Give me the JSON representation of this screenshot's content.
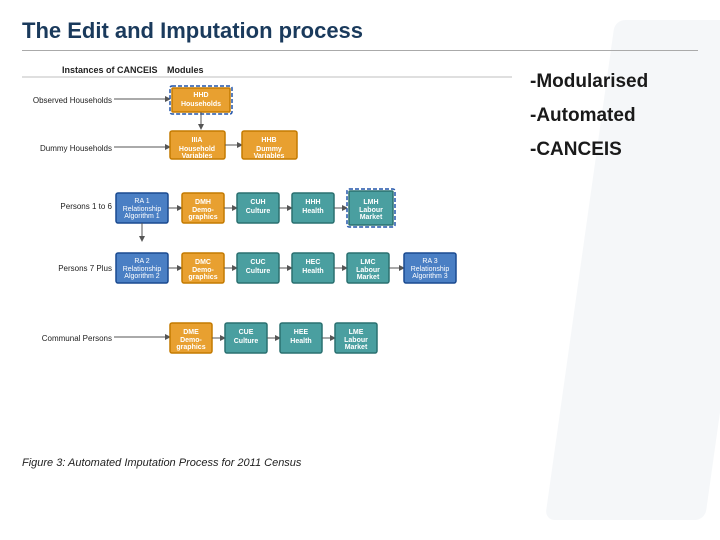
{
  "title": "The Edit and Imputation process",
  "diagram": {
    "col_headers": [
      "Instances of CANCEIS",
      "Modules"
    ],
    "right_labels": [
      "-Modularised",
      "-Automated",
      "-CANCEIS"
    ],
    "figure_caption": "Figure 3: Automated Imputation Process for 2011 Census",
    "rows": [
      {
        "label": "Observed Households"
      },
      {
        "label": "Dummy Households"
      },
      {
        "label": "Persons 1 to 6"
      },
      {
        "label": "Persons 7 Plus"
      },
      {
        "label": "Communal Persons"
      }
    ]
  }
}
